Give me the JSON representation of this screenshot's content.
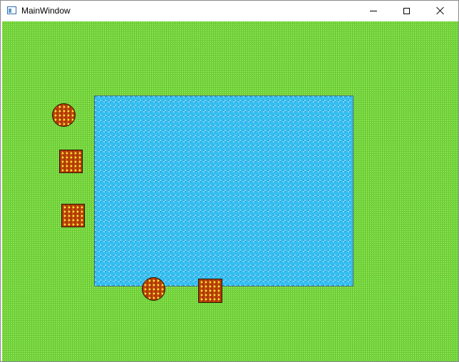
{
  "window": {
    "title": "MainWindow",
    "icon": "app-window-icon",
    "controls": [
      "minimize",
      "maximize",
      "close"
    ]
  },
  "canvas": {
    "background": "grass",
    "water_pool": {
      "fill": "water",
      "color": "#35bff0"
    },
    "tokens": [
      {
        "shape": "circle",
        "color": "#b13a05"
      },
      {
        "shape": "square",
        "color": "#b13a05"
      },
      {
        "shape": "square",
        "color": "#b13a05"
      },
      {
        "shape": "circle",
        "color": "#b13a05"
      },
      {
        "shape": "square",
        "color": "#b13a05"
      }
    ],
    "grass_color": "#6ed43a"
  }
}
